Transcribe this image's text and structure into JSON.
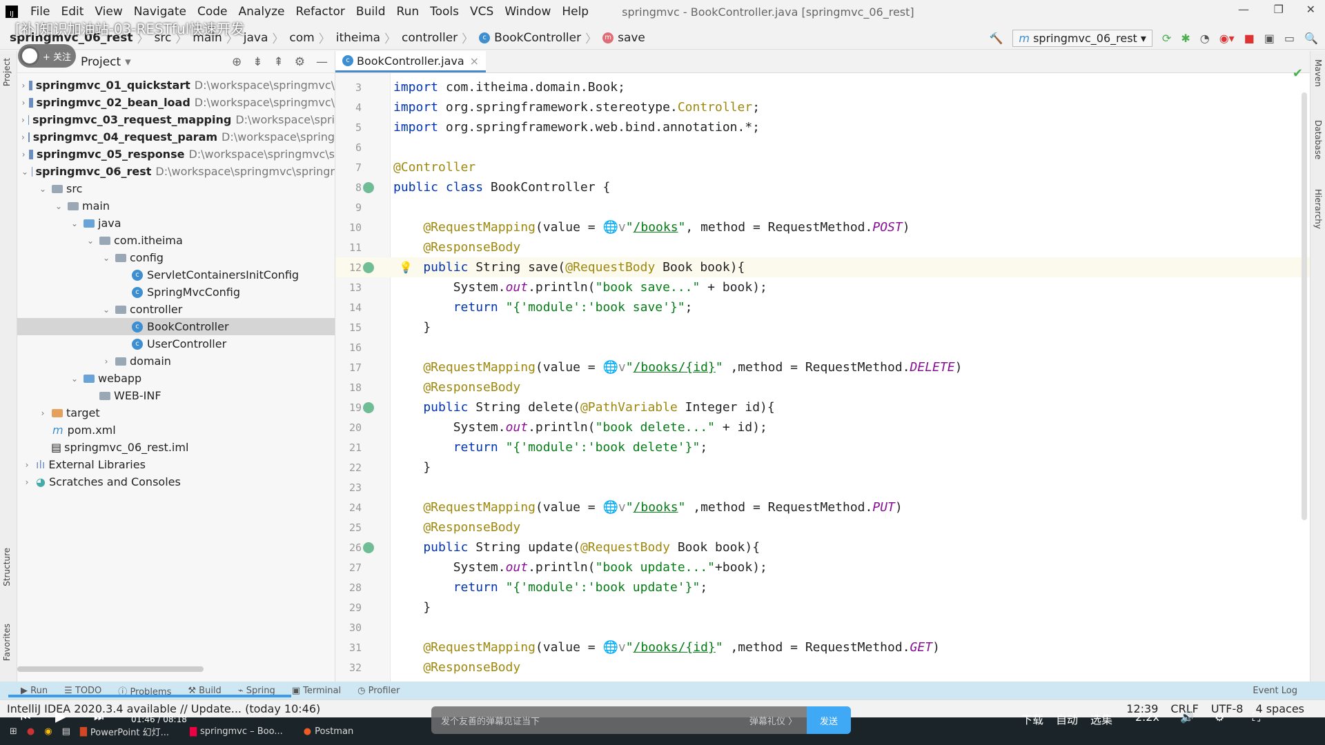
{
  "menu": {
    "items": [
      "File",
      "Edit",
      "View",
      "Navigate",
      "Code",
      "Analyze",
      "Refactor",
      "Build",
      "Run",
      "Tools",
      "VCS",
      "Window",
      "Help"
    ],
    "window_title": "springmvc - BookController.java [springmvc_06_rest]"
  },
  "overlay": {
    "video_title": "[补]知识加油站-03-RESTful快速开发",
    "follow": "+ 关注"
  },
  "breadcrumb": [
    "springmvc_06_rest",
    "src",
    "main",
    "java",
    "com",
    "itheima",
    "controller",
    "BookController",
    "save"
  ],
  "toolbar": {
    "run_config": "springmvc_06_rest"
  },
  "project": {
    "title": "Project",
    "tree": [
      {
        "d": 0,
        "a": ">",
        "i": "mod",
        "name": "springmvc_01_quickstart",
        "bold": true,
        "path": "D:\\workspace\\springmvc\\"
      },
      {
        "d": 0,
        "a": ">",
        "i": "mod",
        "name": "springmvc_02_bean_load",
        "bold": true,
        "path": "D:\\workspace\\springmvc\\"
      },
      {
        "d": 0,
        "a": ">",
        "i": "mod",
        "name": "springmvc_03_request_mapping",
        "bold": true,
        "path": "D:\\workspace\\spri"
      },
      {
        "d": 0,
        "a": ">",
        "i": "mod",
        "name": "springmvc_04_request_param",
        "bold": true,
        "path": "D:\\workspace\\spring"
      },
      {
        "d": 0,
        "a": ">",
        "i": "mod",
        "name": "springmvc_05_response",
        "bold": true,
        "path": "D:\\workspace\\springmvc\\s"
      },
      {
        "d": 0,
        "a": "v",
        "i": "mod",
        "name": "springmvc_06_rest",
        "bold": true,
        "path": "D:\\workspace\\springmvc\\springr"
      },
      {
        "d": 1,
        "a": "v",
        "i": "folder",
        "name": "src"
      },
      {
        "d": 2,
        "a": "v",
        "i": "folder",
        "name": "main"
      },
      {
        "d": 3,
        "a": "v",
        "i": "folder blue",
        "name": "java"
      },
      {
        "d": 4,
        "a": "v",
        "i": "folder",
        "name": "com.itheima"
      },
      {
        "d": 5,
        "a": "v",
        "i": "folder",
        "name": "config"
      },
      {
        "d": 6,
        "a": "",
        "i": "class",
        "name": "ServletContainersInitConfig"
      },
      {
        "d": 6,
        "a": "",
        "i": "class",
        "name": "SpringMvcConfig"
      },
      {
        "d": 5,
        "a": "v",
        "i": "folder",
        "name": "controller"
      },
      {
        "d": 6,
        "a": "",
        "i": "class",
        "name": "BookController",
        "sel": true
      },
      {
        "d": 6,
        "a": "",
        "i": "class",
        "name": "UserController"
      },
      {
        "d": 5,
        "a": ">",
        "i": "folder",
        "name": "domain"
      },
      {
        "d": 3,
        "a": "v",
        "i": "folder blue",
        "name": "webapp"
      },
      {
        "d": 4,
        "a": "",
        "i": "folder",
        "name": "WEB-INF"
      },
      {
        "d": 1,
        "a": ">",
        "i": "folder orange",
        "name": "target"
      },
      {
        "d": 1,
        "a": "",
        "i": "m",
        "name": "pom.xml"
      },
      {
        "d": 1,
        "a": "",
        "i": "file",
        "name": "springmvc_06_rest.iml"
      },
      {
        "d": 0,
        "a": ">",
        "i": "lib",
        "name": "External Libraries"
      },
      {
        "d": 0,
        "a": ">",
        "i": "scr",
        "name": "Scratches and Consoles"
      }
    ]
  },
  "editor": {
    "tab": "BookController.java",
    "lines": [
      {
        "n": "3",
        "t": [
          [
            "kw",
            "import "
          ],
          [
            "",
            "com.itheima.domain."
          ],
          [
            "",
            "Book"
          ],
          [
            "",
            ";"
          ]
        ]
      },
      {
        "n": "4",
        "t": [
          [
            "kw",
            "import "
          ],
          [
            "",
            "org.springframework.stereotype."
          ],
          [
            "ty",
            "Controller"
          ],
          [
            "",
            ";"
          ]
        ]
      },
      {
        "n": "5",
        "t": [
          [
            "kw",
            "import "
          ],
          [
            "",
            "org.springframework.web.bind.annotation.*;"
          ]
        ]
      },
      {
        "n": "6",
        "t": []
      },
      {
        "n": "7",
        "t": [
          [
            "an",
            "@Controller"
          ]
        ]
      },
      {
        "n": "8",
        "g": 1,
        "t": [
          [
            "kw",
            "public class "
          ],
          [
            "",
            "BookController {"
          ]
        ]
      },
      {
        "n": "9",
        "t": []
      },
      {
        "n": "10",
        "t": [
          [
            "an",
            "    @RequestMapping"
          ],
          [
            "",
            "(value = "
          ],
          [
            "gl",
            "🌐v"
          ],
          [
            "st",
            "\""
          ],
          [
            "ur",
            "/books"
          ],
          [
            "st",
            "\""
          ],
          [
            "",
            ", method = RequestMethod."
          ],
          [
            "sti",
            "POST"
          ],
          [
            "",
            ")"
          ]
        ]
      },
      {
        "n": "11",
        "t": [
          [
            "an",
            "    @ResponseBody"
          ]
        ]
      },
      {
        "n": "12",
        "g": 1,
        "cur": 1,
        "b": 1,
        "t": [
          [
            "kw",
            "    public "
          ],
          [
            "",
            "String "
          ],
          [
            "",
            "save("
          ],
          [
            "an",
            "@RequestBody "
          ],
          [
            "",
            "Book book){"
          ]
        ]
      },
      {
        "n": "13",
        "t": [
          [
            "",
            "        System."
          ],
          [
            "sti",
            "out"
          ],
          [
            "",
            ".println("
          ],
          [
            "st",
            "\"book save...\""
          ],
          [
            "",
            "",
            " + book);"
          ]
        ]
      },
      {
        "n": "14",
        "t": [
          [
            "kw",
            "        return "
          ],
          [
            "st",
            "\"{'module':'book save'}\""
          ],
          [
            "",
            ";"
          ]
        ]
      },
      {
        "n": "15",
        "t": [
          [
            "",
            "    }"
          ]
        ]
      },
      {
        "n": "16",
        "t": []
      },
      {
        "n": "17",
        "t": [
          [
            "an",
            "    @RequestMapping"
          ],
          [
            "",
            "(value = "
          ],
          [
            "gl",
            "🌐v"
          ],
          [
            "st",
            "\""
          ],
          [
            "ur",
            "/books/{id}"
          ],
          [
            "st",
            "\""
          ],
          [
            "",
            " ,method = RequestMethod."
          ],
          [
            "sti",
            "DELETE"
          ],
          [
            "",
            ")"
          ]
        ]
      },
      {
        "n": "18",
        "t": [
          [
            "an",
            "    @ResponseBody"
          ]
        ]
      },
      {
        "n": "19",
        "g": 1,
        "t": [
          [
            "kw",
            "    public "
          ],
          [
            "",
            "String delete("
          ],
          [
            "an",
            "@PathVariable "
          ],
          [
            "",
            "Integer id){"
          ]
        ]
      },
      {
        "n": "20",
        "t": [
          [
            "",
            "        System."
          ],
          [
            "sti",
            "out"
          ],
          [
            "",
            ".println("
          ],
          [
            "st",
            "\"book delete...\""
          ],
          [
            "",
            " + id);"
          ]
        ]
      },
      {
        "n": "21",
        "t": [
          [
            "kw",
            "        return "
          ],
          [
            "st",
            "\"{'module':'book delete'}\""
          ],
          [
            "",
            ";"
          ]
        ]
      },
      {
        "n": "22",
        "t": [
          [
            "",
            "    }"
          ]
        ]
      },
      {
        "n": "23",
        "t": []
      },
      {
        "n": "24",
        "t": [
          [
            "an",
            "    @RequestMapping"
          ],
          [
            "",
            "(value = "
          ],
          [
            "gl",
            "🌐v"
          ],
          [
            "st",
            "\""
          ],
          [
            "ur",
            "/books"
          ],
          [
            "st",
            "\""
          ],
          [
            "",
            " ,method = RequestMethod."
          ],
          [
            "sti",
            "PUT"
          ],
          [
            "",
            ")"
          ]
        ]
      },
      {
        "n": "25",
        "t": [
          [
            "an",
            "    @ResponseBody"
          ]
        ]
      },
      {
        "n": "26",
        "g": 1,
        "t": [
          [
            "kw",
            "    public "
          ],
          [
            "",
            "String update("
          ],
          [
            "an",
            "@RequestBody "
          ],
          [
            "",
            "Book book){"
          ]
        ]
      },
      {
        "n": "27",
        "t": [
          [
            "",
            "        System."
          ],
          [
            "sti",
            "out"
          ],
          [
            "",
            ".println("
          ],
          [
            "st",
            "\"book update...\""
          ],
          [
            "",
            "+book);"
          ]
        ]
      },
      {
        "n": "28",
        "t": [
          [
            "kw",
            "        return "
          ],
          [
            "st",
            "\"{'module':'book update'}\""
          ],
          [
            "",
            ";"
          ]
        ]
      },
      {
        "n": "29",
        "t": [
          [
            "",
            "    }"
          ]
        ]
      },
      {
        "n": "30",
        "t": []
      },
      {
        "n": "31",
        "t": [
          [
            "an",
            "    @RequestMapping"
          ],
          [
            "",
            "(value = "
          ],
          [
            "gl",
            "🌐v"
          ],
          [
            "st",
            "\""
          ],
          [
            "ur",
            "/books/{id}"
          ],
          [
            "st",
            "\""
          ],
          [
            "",
            " ,method = RequestMethod."
          ],
          [
            "sti",
            "GET"
          ],
          [
            "",
            ")"
          ]
        ]
      },
      {
        "n": "32",
        "t": [
          [
            "an",
            "    @ResponseBody"
          ]
        ]
      }
    ]
  },
  "side": {
    "left": [
      "Project",
      "Structure",
      "Favorites"
    ],
    "right": [
      "Maven",
      "Database",
      "Hierarchy"
    ]
  },
  "tooltabs": {
    "items": [
      "Run",
      "TODO",
      "Problems",
      "Build",
      "Spring",
      "Terminal",
      "Profiler"
    ],
    "event_log": "Event Log"
  },
  "status": {
    "message": "IntelliJ IDEA 2020.3.4 available // Update... (today 10:46)",
    "position": "12:39",
    "line_sep": "CRLF",
    "encoding": "UTF-8",
    "indent": "4 spaces"
  },
  "player": {
    "time": "01:46 / 08:18",
    "danmu_placeholder": "发个友善的弹幕见证当下",
    "gift": "弹幕礼仪 〉",
    "send": "发送",
    "download": "下载",
    "auto": "自动",
    "episodes": "选集",
    "speed": "2.2x"
  },
  "taskbar": {
    "apps": [
      "PowerPoint 幻灯...",
      "springmvc – Boo...",
      "Postman"
    ]
  }
}
